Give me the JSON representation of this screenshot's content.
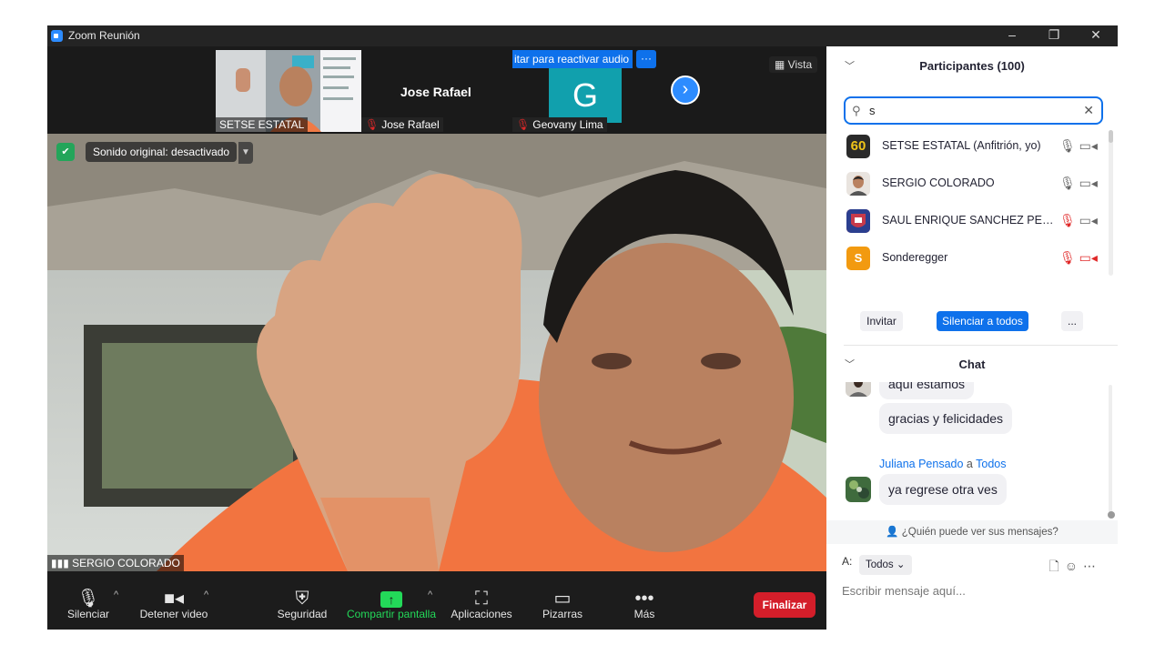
{
  "window": {
    "title": "Zoom Reunión",
    "controls": [
      "–",
      "❐",
      "✕"
    ]
  },
  "strip": {
    "thumbs": [
      {
        "label": "SETSE ESTATAL"
      },
      {
        "name": "Jose Rafael",
        "label": "Jose Rafael"
      },
      {
        "banner": "itar para reactivar audio",
        "more": "···",
        "initial": "G",
        "label": "Geovany Lima"
      }
    ],
    "next_arrow": "›",
    "view_label": "Vista"
  },
  "main_video": {
    "sound_pill": "Sonido original: desactivado",
    "speaker_label": "SERGIO COLORADO"
  },
  "toolbar": {
    "mute": "Silenciar",
    "stop_video": "Detener video",
    "security": "Seguridad",
    "share": "Compartir pantalla",
    "apps": "Aplicaciones",
    "whiteboards": "Pizarras",
    "more": "Más",
    "end": "Finalizar"
  },
  "participants": {
    "header": "Participantes (100)",
    "search_value": "s",
    "list": [
      {
        "name": "SETSE ESTATAL (Anfitrión, yo)",
        "avatar_text": "60",
        "avatar_color": "#2a2a2a"
      },
      {
        "name": "SERGIO COLORADO",
        "avatar_text": "",
        "avatar_color": "#c9a48a"
      },
      {
        "name": "SAUL ENRIQUE SANCHEZ PERE...",
        "avatar_text": "",
        "avatar_color": "#c73a4b"
      },
      {
        "name": "Sonderegger",
        "avatar_text": "S",
        "avatar_color": "#f29a10"
      }
    ],
    "invite": "Invitar",
    "mute_all": "Silenciar a todos",
    "more": "..."
  },
  "chat": {
    "header": "Chat",
    "messages": [
      {
        "text": "aquí estamos"
      },
      {
        "text": "gracias y felicidades"
      },
      {
        "sender": "Juliana Pensado",
        "to_word": "a",
        "to": "Todos",
        "text": "ya regrese otra ves"
      }
    ],
    "who_can_see": "¿Quién puede ver sus mensajes?",
    "to_label": "A:",
    "to_value": "Todos",
    "input_placeholder": "Escribir mensaje aquí..."
  },
  "colors": {
    "accent": "#0e71eb",
    "end": "#d41e2a",
    "share_green": "#23d959",
    "mic_off_red": "#e02828"
  }
}
